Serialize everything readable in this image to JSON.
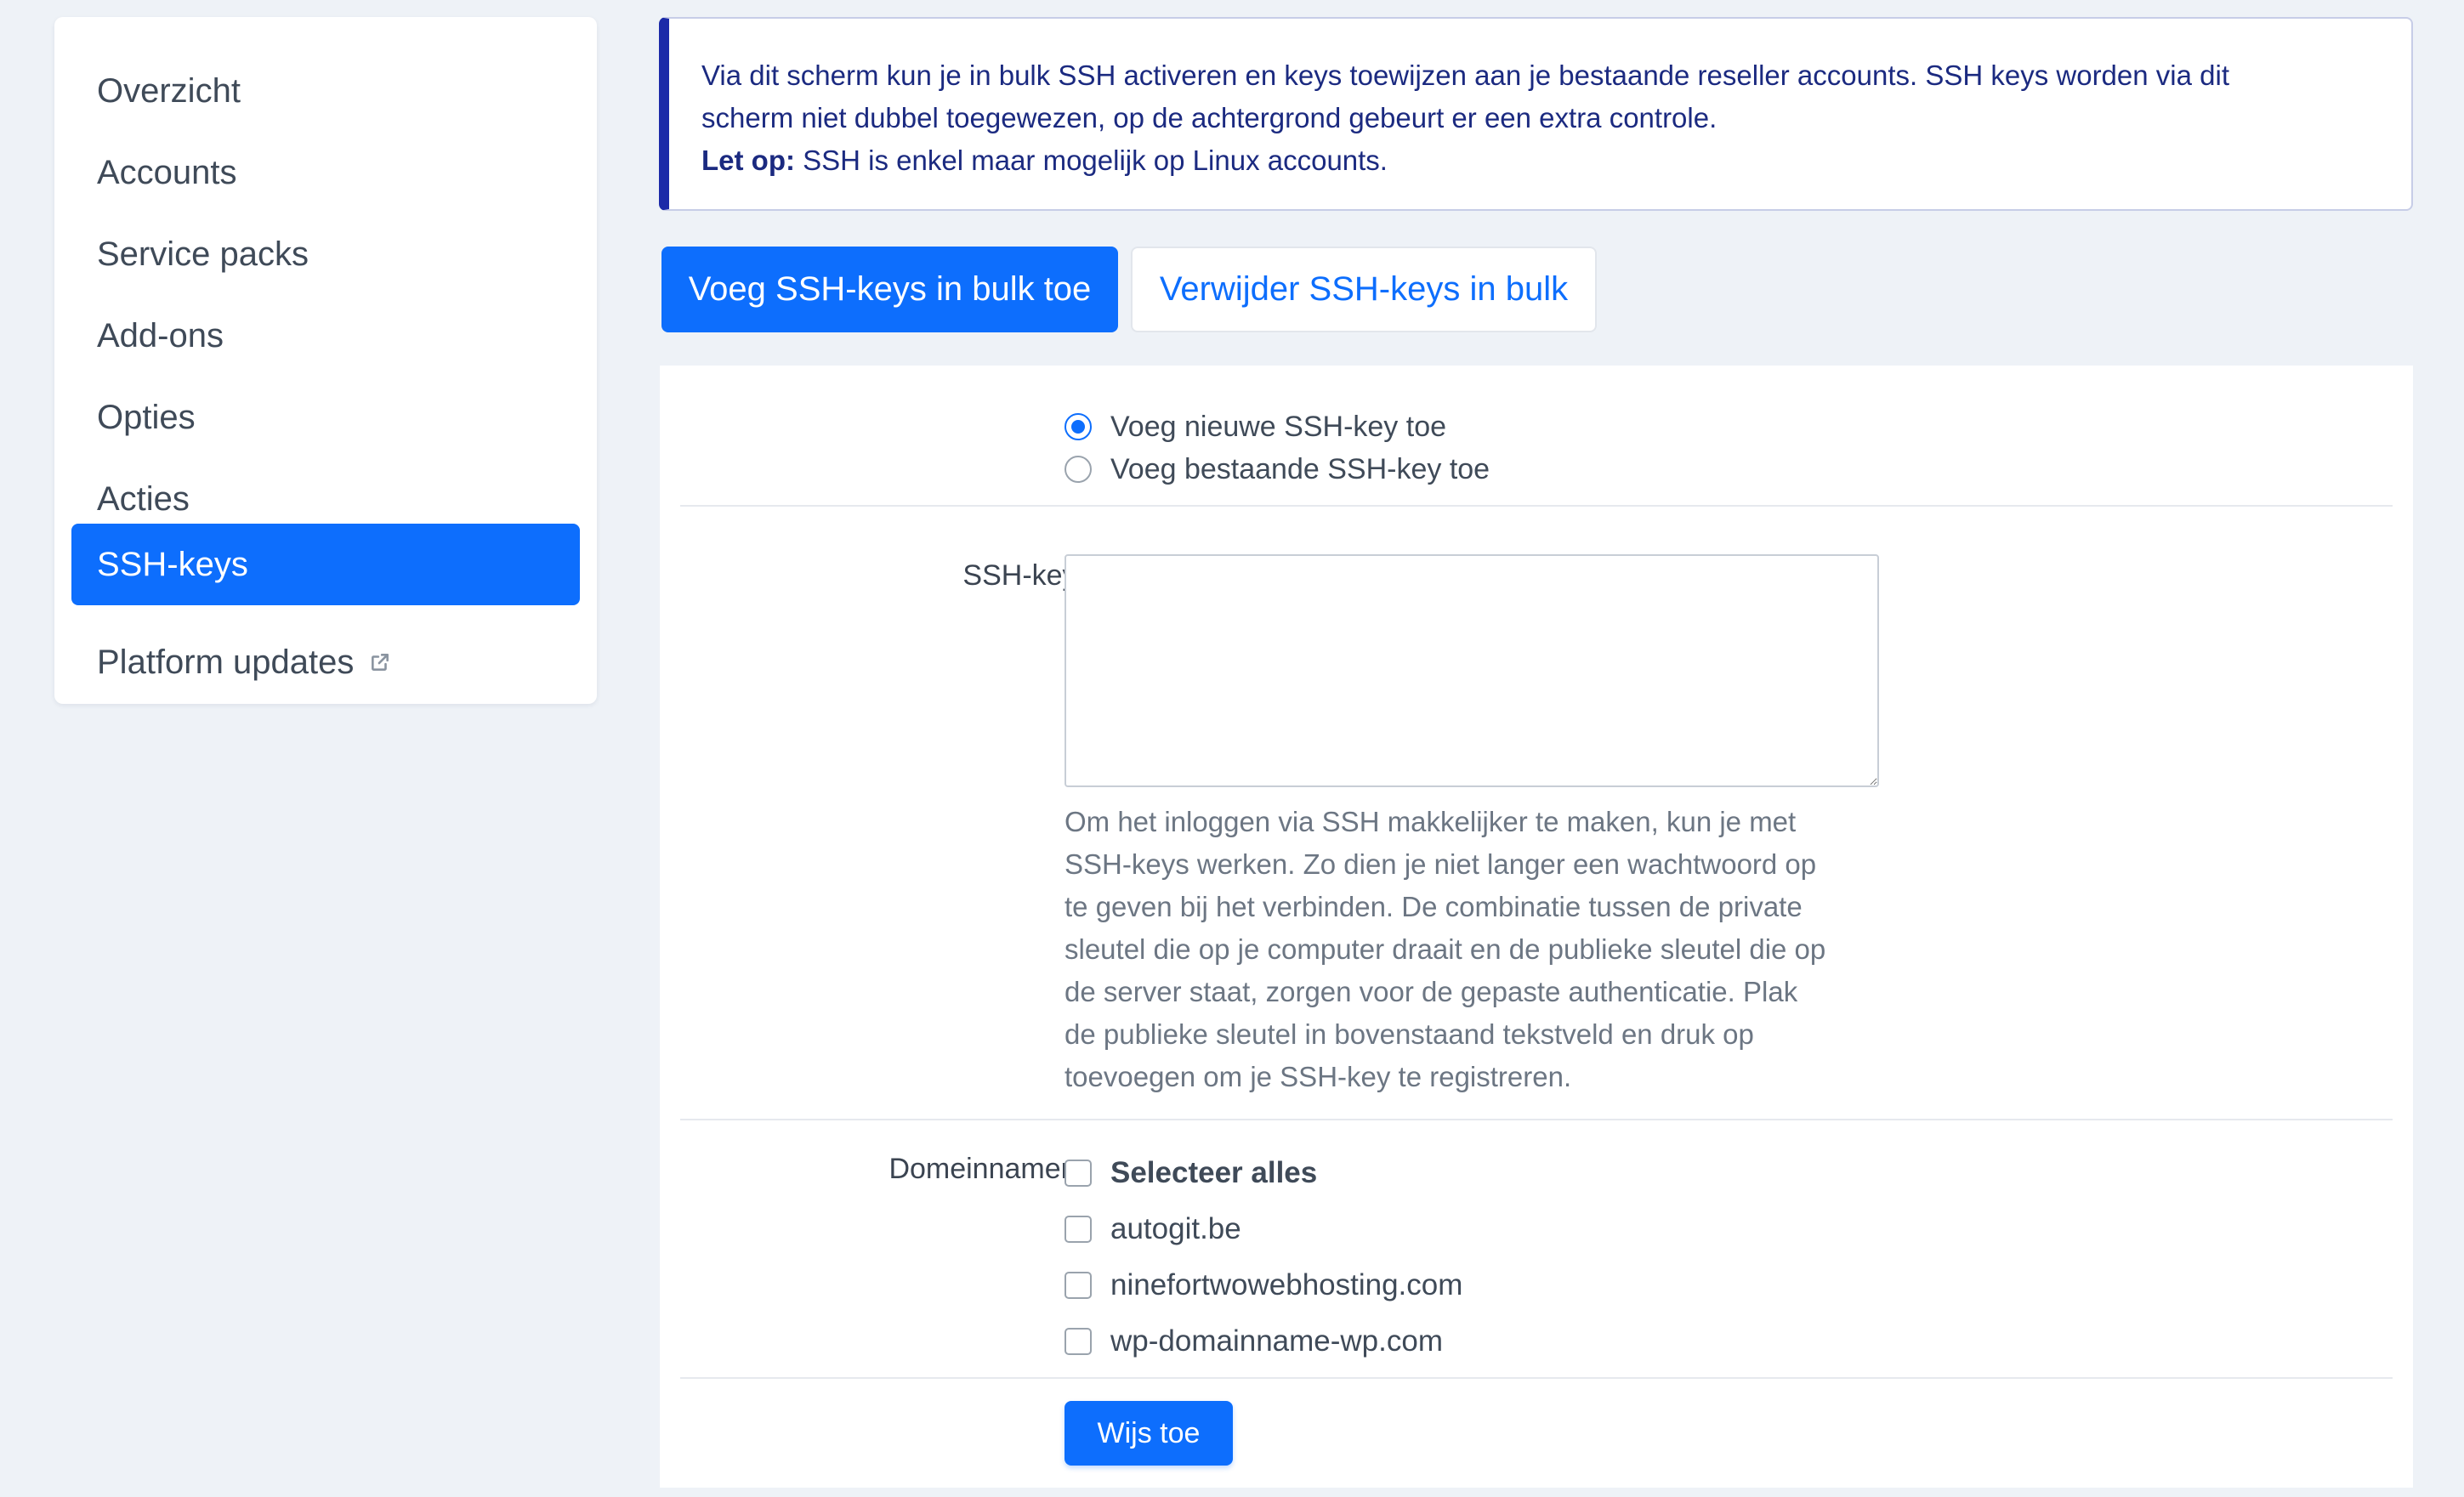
{
  "sidebar": {
    "items": [
      {
        "label": "Overzicht"
      },
      {
        "label": "Accounts"
      },
      {
        "label": "Service packs"
      },
      {
        "label": "Add-ons"
      },
      {
        "label": "Opties"
      },
      {
        "label": "Acties"
      },
      {
        "label": "SSH-keys",
        "active": true
      },
      {
        "label": "Platform updates",
        "icon": "external-link-icon"
      }
    ]
  },
  "notice": {
    "line1": "Via dit scherm kun je in bulk SSH activeren en keys toewijzen aan je bestaande reseller accounts. SSH keys worden via dit",
    "line2": "scherm niet dubbel toegewezen, op de achtergrond gebeurt er een extra controle.",
    "note_label": "Let op:",
    "note_text": " SSH is enkel maar mogelijk op Linux accounts."
  },
  "tabs": {
    "add": "Voeg SSH-keys in bulk toe",
    "remove": "Verwijder SSH-keys in bulk"
  },
  "form": {
    "radio_new": "Voeg nieuwe SSH-key toe",
    "radio_existing": "Voeg bestaande SSH-key toe",
    "ssh_key_label": "SSH-key:",
    "ssh_key_value": "",
    "help_lines": [
      "Om het inloggen via SSH makkelijker te maken, kun je met",
      "SSH-keys werken. Zo dien je niet langer een wachtwoord op",
      "te geven bij het verbinden. De combinatie tussen de private",
      "sleutel die op je computer draait en de publieke sleutel die op",
      "de server staat, zorgen voor de gepaste authenticatie. Plak",
      "de publieke sleutel in bovenstaand tekstveld en druk op",
      "toevoegen om je SSH-key te registreren."
    ],
    "domains_label": "Domeinnamen:",
    "select_all": "Selecteer alles",
    "domains": [
      "autogit.be",
      "ninefortwowebhosting.com",
      "wp-domainname-wp.com"
    ],
    "submit": "Wijs toe"
  },
  "colors": {
    "accent": "#0d6efd",
    "notice_border": "#1b2aa8",
    "background": "#eef2f7"
  }
}
